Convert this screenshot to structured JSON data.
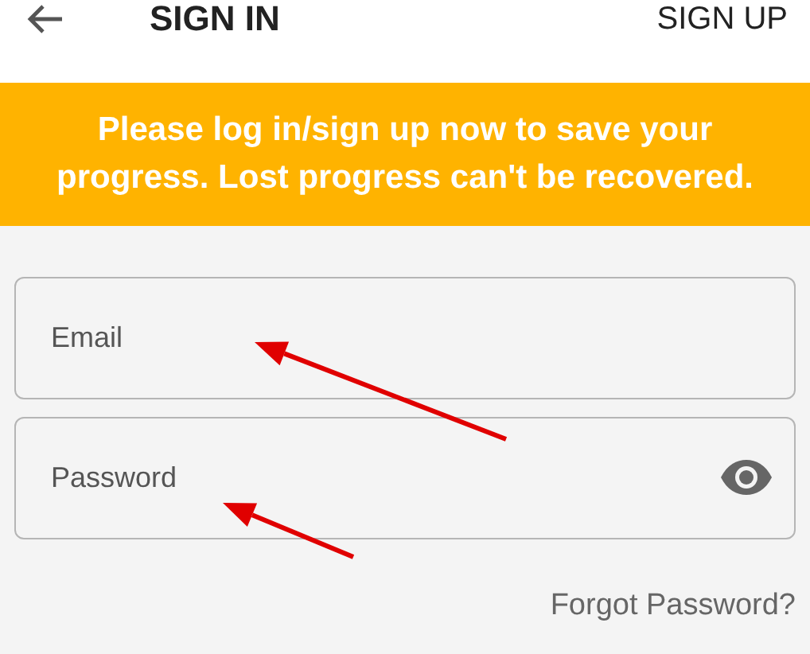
{
  "app_bar": {
    "title": "SIGN IN",
    "action": "SIGN UP"
  },
  "banner": {
    "message": "Please log in/sign up now to save your progress. Lost progress can't be recovered."
  },
  "fields": [
    {
      "kind": "text",
      "placeholder": "Email"
    },
    {
      "kind": "password",
      "placeholder": "Password"
    }
  ],
  "forgot_link": "Forgot Password?"
}
